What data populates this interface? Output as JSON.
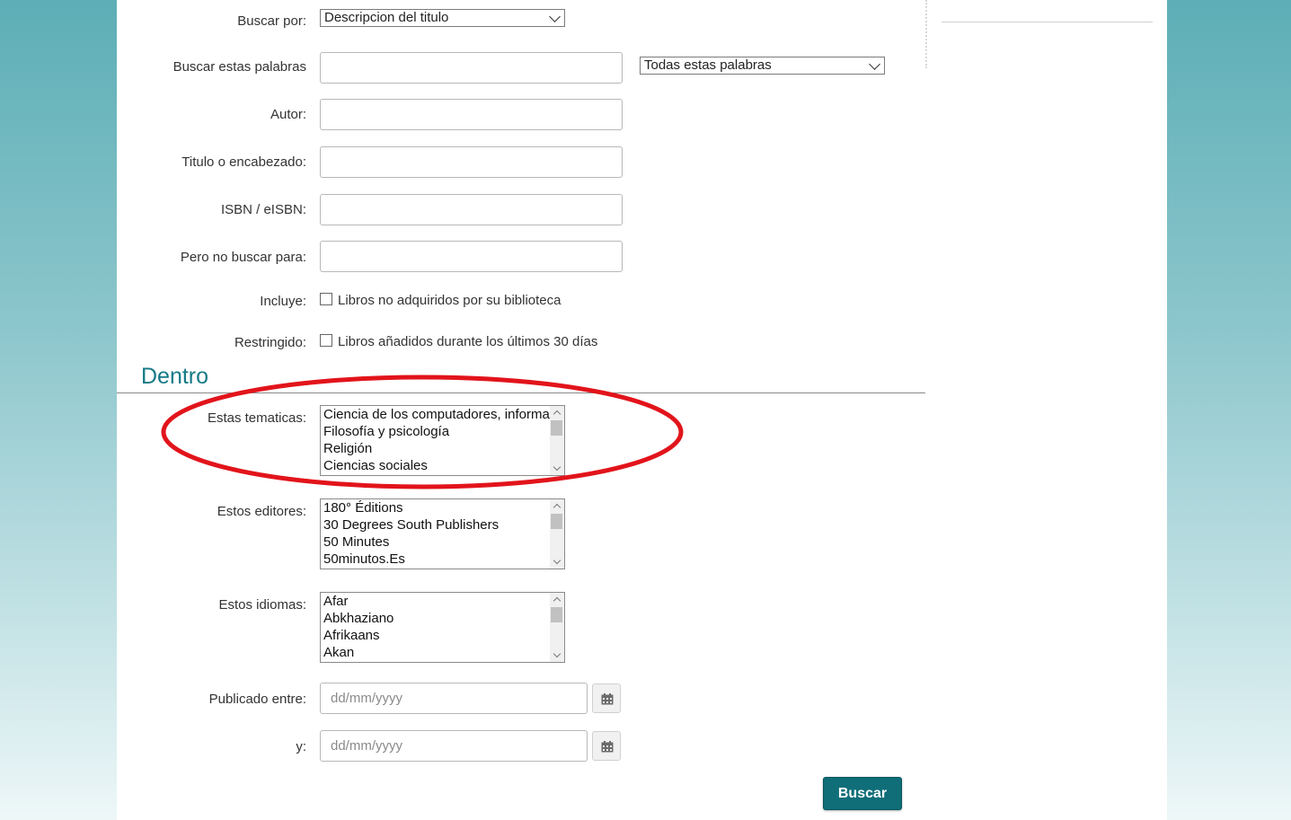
{
  "form": {
    "buscar_por": {
      "label": "Buscar por:",
      "selected": "Descripcion del titulo"
    },
    "buscar_palabras": {
      "label": "Buscar estas palabras",
      "value": "",
      "mode_selected": "Todas estas palabras"
    },
    "autor": {
      "label": "Autor:",
      "value": ""
    },
    "titulo": {
      "label": "Titulo o encabezado:",
      "value": ""
    },
    "isbn": {
      "label": "ISBN / eISBN:",
      "value": ""
    },
    "excluir": {
      "label": "Pero no buscar para:",
      "value": ""
    },
    "incluye": {
      "label": "Incluye:",
      "checkbox_label": "Libros no adquiridos por su biblioteca"
    },
    "restringido": {
      "label": "Restringido:",
      "checkbox_label": "Libros añadidos durante los últimos 30 días"
    }
  },
  "dentro": {
    "title": "Dentro",
    "tematicas": {
      "label": "Estas tematicas:",
      "options": [
        "Ciencia de los computadores, información",
        "Filosofía y psicología",
        "Religión",
        "Ciencias sociales"
      ]
    },
    "editores": {
      "label": "Estos editores:",
      "options": [
        "180° Éditions",
        "30 Degrees South Publishers",
        "50 Minutes",
        "50minutos.Es"
      ]
    },
    "idiomas": {
      "label": "Estos idiomas:",
      "options": [
        "Afar",
        "Abkhaziano",
        "Afrikaans",
        "Akan"
      ]
    },
    "publicado_entre": {
      "label": "Publicado entre:",
      "placeholder": "dd/mm/yyyy"
    },
    "y": {
      "label": "y:",
      "placeholder": "dd/mm/yyyy"
    }
  },
  "buttons": {
    "buscar": "Buscar"
  },
  "icons": {
    "calendar": "calendar-icon",
    "dropdown": "chevron-down-icon"
  },
  "colors": {
    "accent": "#167a86",
    "button": "#0f6e78",
    "highlight": "#e2141b"
  }
}
